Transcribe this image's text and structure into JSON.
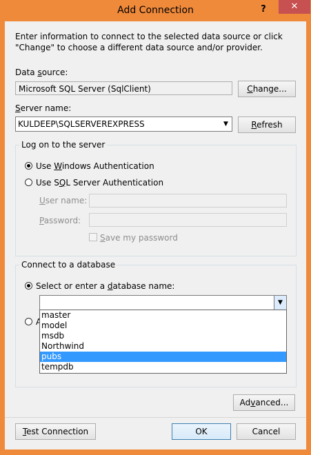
{
  "window": {
    "title": "Add Connection",
    "help_glyph": "?",
    "close_glyph": "✕"
  },
  "intro_text": "Enter information to connect to the selected data source or click \"Change\" to choose a different data source and/or provider.",
  "data_source": {
    "label_pre": "Data ",
    "label_ul": "s",
    "label_post": "ource:",
    "value": "Microsoft SQL Server (SqlClient)",
    "change_pre": "",
    "change_ul": "C",
    "change_post": "hange..."
  },
  "server": {
    "label_pre": "",
    "label_ul": "S",
    "label_post": "erver name:",
    "value": "KULDEEP\\SQLSERVEREXPRESS",
    "refresh_pre": "",
    "refresh_ul": "R",
    "refresh_post": "efresh"
  },
  "logon": {
    "title": "Log on to the server",
    "windows_auth_pre": "Use ",
    "windows_auth_ul": "W",
    "windows_auth_post": "indows Authentication",
    "sql_auth_pre": "Use S",
    "sql_auth_ul": "Q",
    "sql_auth_post": "L Server Authentication",
    "username_pre": "",
    "username_ul": "U",
    "username_post": "ser name:",
    "password_pre": "",
    "password_ul": "P",
    "password_post": "assword:",
    "save_pre": "",
    "save_ul": "S",
    "save_post": "ave my password"
  },
  "database": {
    "title": "Connect to a database",
    "select_pre": "Select or enter a ",
    "select_ul": "d",
    "select_post": "atabase name:",
    "attach_letter": "A",
    "input_value": "",
    "options": [
      "master",
      "model",
      "msdb",
      "Northwind",
      "pubs",
      "tempdb"
    ],
    "selected_option": "pubs"
  },
  "buttons": {
    "advanced_pre": "Ad",
    "advanced_ul": "v",
    "advanced_post": "anced...",
    "test_pre": "",
    "test_ul": "T",
    "test_post": "est Connection",
    "ok": "OK",
    "cancel": "Cancel"
  },
  "colors": {
    "frame": "#f08a3b",
    "close": "#c75050",
    "selection": "#3399ff"
  }
}
